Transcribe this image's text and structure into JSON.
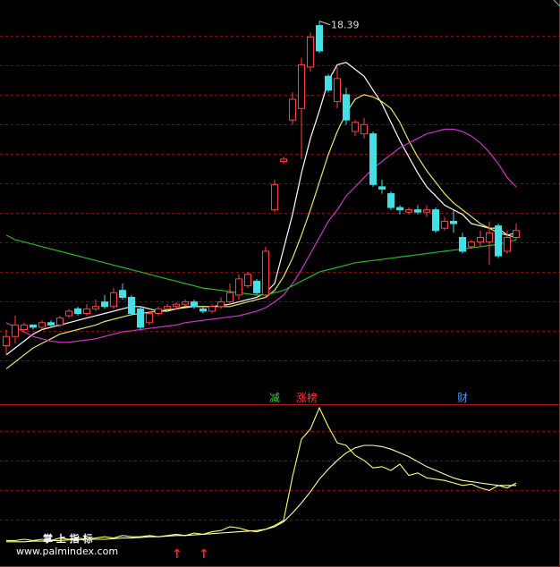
{
  "chart_data": [
    {
      "type": "candlestick",
      "panel": "price",
      "max_price_label": "18.39",
      "ylim": [
        3.0,
        19.0
      ],
      "grid": "horizontal dashed",
      "candles": [
        {
          "o": 4.3,
          "c": 4.7,
          "h": 5.0,
          "l": 3.9,
          "up": true
        },
        {
          "o": 4.7,
          "c": 5.2,
          "h": 5.6,
          "l": 4.4,
          "up": true
        },
        {
          "o": 5.0,
          "c": 5.2,
          "h": 5.3,
          "l": 4.9,
          "up": true
        },
        {
          "o": 5.2,
          "c": 5.1,
          "h": 5.2,
          "l": 5.0,
          "up": false
        },
        {
          "o": 5.1,
          "c": 5.3,
          "h": 5.4,
          "l": 5.0,
          "up": true
        },
        {
          "o": 5.3,
          "c": 5.2,
          "h": 5.4,
          "l": 5.1,
          "up": false
        },
        {
          "o": 5.2,
          "c": 5.5,
          "h": 5.6,
          "l": 5.1,
          "up": true
        },
        {
          "o": 5.6,
          "c": 5.8,
          "h": 5.9,
          "l": 5.5,
          "up": true
        },
        {
          "o": 5.9,
          "c": 5.7,
          "h": 6.0,
          "l": 5.6,
          "up": false
        },
        {
          "o": 5.7,
          "c": 5.9,
          "h": 6.1,
          "l": 5.6,
          "up": true
        },
        {
          "o": 5.9,
          "c": 6.0,
          "h": 6.3,
          "l": 5.8,
          "up": true
        },
        {
          "o": 6.2,
          "c": 6.0,
          "h": 6.5,
          "l": 5.9,
          "up": false
        },
        {
          "o": 6.0,
          "c": 6.6,
          "h": 6.8,
          "l": 5.9,
          "up": true
        },
        {
          "o": 6.7,
          "c": 6.4,
          "h": 7.0,
          "l": 6.3,
          "up": false
        },
        {
          "o": 6.4,
          "c": 5.7,
          "h": 6.5,
          "l": 5.6,
          "up": false
        },
        {
          "o": 5.9,
          "c": 5.1,
          "h": 6.0,
          "l": 5.0,
          "up": false
        },
        {
          "o": 5.3,
          "c": 5.7,
          "h": 5.8,
          "l": 5.2,
          "up": true
        },
        {
          "o": 5.7,
          "c": 5.9,
          "h": 6.0,
          "l": 5.6,
          "up": true
        },
        {
          "o": 5.9,
          "c": 6.0,
          "h": 6.1,
          "l": 5.8,
          "up": true
        },
        {
          "o": 6.0,
          "c": 6.1,
          "h": 6.2,
          "l": 5.9,
          "up": true
        },
        {
          "o": 6.1,
          "c": 6.2,
          "h": 6.3,
          "l": 6.0,
          "up": true
        },
        {
          "o": 6.2,
          "c": 6.0,
          "h": 6.3,
          "l": 5.9,
          "up": false
        },
        {
          "o": 5.9,
          "c": 5.8,
          "h": 6.0,
          "l": 5.7,
          "up": false
        },
        {
          "o": 5.8,
          "c": 6.0,
          "h": 6.1,
          "l": 5.7,
          "up": true
        },
        {
          "o": 6.0,
          "c": 6.2,
          "h": 6.4,
          "l": 5.9,
          "up": true
        },
        {
          "o": 6.2,
          "c": 6.6,
          "h": 7.0,
          "l": 6.1,
          "up": true
        },
        {
          "o": 6.5,
          "c": 7.2,
          "h": 7.4,
          "l": 6.3,
          "up": true
        },
        {
          "o": 6.9,
          "c": 7.4,
          "h": 7.5,
          "l": 6.8,
          "up": true
        },
        {
          "o": 7.1,
          "c": 6.6,
          "h": 7.2,
          "l": 6.5,
          "up": false
        },
        {
          "o": 6.5,
          "c": 8.4,
          "h": 8.6,
          "l": 6.4,
          "up": true
        },
        {
          "o": 10.2,
          "c": 11.3,
          "h": 11.5,
          "l": 10.1,
          "up": true
        },
        {
          "o": 12.3,
          "c": 12.4,
          "h": 12.5,
          "l": 12.2,
          "up": true
        },
        {
          "o": 14.1,
          "c": 15.0,
          "h": 15.3,
          "l": 13.9,
          "up": true
        },
        {
          "o": 14.6,
          "c": 16.5,
          "h": 16.8,
          "l": 12.4,
          "up": true
        },
        {
          "o": 16.4,
          "c": 17.7,
          "h": 17.9,
          "l": 16.2,
          "up": true
        },
        {
          "o": 18.2,
          "c": 17.1,
          "h": 18.39,
          "l": 17.0,
          "up": false
        },
        {
          "o": 16.0,
          "c": 15.4,
          "h": 16.1,
          "l": 15.3,
          "up": false
        },
        {
          "o": 14.9,
          "c": 15.9,
          "h": 16.4,
          "l": 14.6,
          "up": true
        },
        {
          "o": 15.2,
          "c": 14.1,
          "h": 15.5,
          "l": 13.9,
          "up": false
        },
        {
          "o": 13.6,
          "c": 14.0,
          "h": 14.1,
          "l": 13.4,
          "up": true
        },
        {
          "o": 13.5,
          "c": 13.9,
          "h": 14.2,
          "l": 13.3,
          "up": true
        },
        {
          "o": 13.5,
          "c": 11.3,
          "h": 13.6,
          "l": 11.2,
          "up": false
        },
        {
          "o": 11.2,
          "c": 11.1,
          "h": 11.5,
          "l": 10.9,
          "up": false
        },
        {
          "o": 10.9,
          "c": 10.3,
          "h": 11.0,
          "l": 10.2,
          "up": false
        },
        {
          "o": 10.3,
          "c": 10.2,
          "h": 10.4,
          "l": 10.0,
          "up": false
        },
        {
          "o": 10.1,
          "c": 10.2,
          "h": 10.3,
          "l": 10.0,
          "up": true
        },
        {
          "o": 10.2,
          "c": 10.1,
          "h": 10.4,
          "l": 10.0,
          "up": false
        },
        {
          "o": 10.1,
          "c": 10.2,
          "h": 10.4,
          "l": 9.9,
          "up": true
        },
        {
          "o": 10.2,
          "c": 9.3,
          "h": 10.3,
          "l": 9.2,
          "up": false
        },
        {
          "o": 9.4,
          "c": 9.7,
          "h": 9.9,
          "l": 9.3,
          "up": true
        },
        {
          "o": 9.7,
          "c": 9.6,
          "h": 10.2,
          "l": 9.2,
          "up": false
        },
        {
          "o": 9.0,
          "c": 8.4,
          "h": 9.2,
          "l": 8.3,
          "up": false
        },
        {
          "o": 8.6,
          "c": 8.8,
          "h": 8.9,
          "l": 8.5,
          "up": true
        },
        {
          "o": 8.8,
          "c": 9.0,
          "h": 9.3,
          "l": 8.6,
          "up": true
        },
        {
          "o": 8.8,
          "c": 9.2,
          "h": 9.7,
          "l": 7.8,
          "up": true
        },
        {
          "o": 9.5,
          "c": 8.2,
          "h": 9.6,
          "l": 8.1,
          "up": false
        },
        {
          "o": 8.4,
          "c": 9.0,
          "h": 9.3,
          "l": 8.3,
          "up": true
        },
        {
          "o": 9.0,
          "c": 9.3,
          "h": 9.6,
          "l": 8.9,
          "up": true
        }
      ],
      "ma_series": [
        {
          "color": "#ffffff",
          "values": [
            3.9,
            4.2,
            4.5,
            4.8,
            5.0,
            5.1,
            5.2,
            5.3,
            5.4,
            5.5,
            5.6,
            5.7,
            5.8,
            5.9,
            6.0,
            6.0,
            5.9,
            5.8,
            5.8,
            5.9,
            6.0,
            6.0,
            6.0,
            6.0,
            6.05,
            6.1,
            6.2,
            6.3,
            6.4,
            6.6,
            7.0,
            8.5,
            10.0,
            11.8,
            13.3,
            14.5,
            15.8,
            16.5,
            16.6,
            16.3,
            16.0,
            15.4,
            14.8,
            14.0,
            13.2,
            12.5,
            11.8,
            11.2,
            10.8,
            10.4,
            10.2,
            10.0,
            9.6,
            9.5,
            9.4,
            9.4,
            9.1,
            9.2
          ]
        },
        {
          "color": "#e8e85a",
          "values": [
            3.3,
            3.6,
            3.9,
            4.2,
            4.4,
            4.6,
            4.8,
            4.9,
            5.0,
            5.1,
            5.2,
            5.35,
            5.45,
            5.55,
            5.65,
            5.7,
            5.75,
            5.8,
            5.85,
            5.9,
            5.95,
            6.0,
            6.0,
            6.0,
            6.0,
            6.0,
            6.1,
            6.2,
            6.3,
            6.4,
            6.7,
            7.3,
            8.1,
            9.1,
            10.2,
            11.4,
            12.6,
            13.6,
            14.4,
            15.0,
            15.2,
            15.1,
            14.9,
            14.6,
            14.0,
            13.2,
            12.5,
            11.9,
            11.4,
            10.9,
            10.5,
            10.2,
            9.9,
            9.6,
            9.4,
            9.2,
            9.1,
            9.0
          ]
        },
        {
          "color": "#cc33cc",
          "values": [
            5.3,
            5.1,
            4.9,
            4.7,
            4.6,
            4.5,
            4.45,
            4.45,
            4.5,
            4.55,
            4.6,
            4.7,
            4.8,
            4.9,
            4.95,
            5.0,
            5.05,
            5.1,
            5.15,
            5.2,
            5.3,
            5.35,
            5.4,
            5.45,
            5.5,
            5.55,
            5.6,
            5.7,
            5.8,
            5.95,
            6.2,
            6.5,
            7.0,
            7.6,
            8.3,
            9.0,
            9.7,
            10.2,
            10.8,
            11.2,
            11.6,
            12.0,
            12.3,
            12.6,
            12.9,
            13.1,
            13.3,
            13.5,
            13.6,
            13.7,
            13.7,
            13.6,
            13.4,
            13.1,
            12.7,
            12.2,
            11.6,
            11.2
          ]
        },
        {
          "color": "#22bb22",
          "values": [
            9.1,
            8.9,
            8.8,
            8.7,
            8.6,
            8.5,
            8.4,
            8.3,
            8.2,
            8.1,
            8.0,
            7.9,
            7.8,
            7.7,
            7.6,
            7.5,
            7.4,
            7.3,
            7.2,
            7.1,
            7.0,
            6.9,
            6.8,
            6.75,
            6.7,
            6.65,
            6.6,
            6.55,
            6.5,
            6.5,
            6.6,
            6.7,
            6.9,
            7.1,
            7.3,
            7.5,
            7.6,
            7.7,
            7.8,
            7.9,
            7.95,
            8.0,
            8.05,
            8.1,
            8.15,
            8.2,
            8.25,
            8.3,
            8.35,
            8.4,
            8.45,
            8.5,
            8.55,
            8.6,
            8.65,
            8.7,
            8.8,
            8.9
          ]
        }
      ],
      "signals": [
        {
          "text": "减",
          "color": "#33cc33",
          "candle": 30
        },
        {
          "text": "涨榜",
          "color": "#ff3333",
          "candle": 33
        },
        {
          "text": "财",
          "color": "#3399ff",
          "candle": 51
        }
      ]
    },
    {
      "type": "line",
      "panel": "indicator",
      "ylim": [
        0,
        100
      ],
      "series": [
        {
          "color": "#ffff66",
          "values": [
            4,
            4,
            5,
            4,
            5,
            4,
            6,
            5,
            6,
            5,
            6,
            7,
            6,
            8,
            7,
            7,
            8,
            7,
            8,
            9,
            8,
            10,
            9,
            11,
            12,
            15,
            14,
            12,
            11,
            13,
            16,
            20,
            55,
            85,
            93,
            110,
            95,
            82,
            80,
            72,
            68,
            62,
            63,
            60,
            65,
            56,
            58,
            54,
            53,
            52,
            50,
            48,
            49,
            46,
            44,
            48,
            46,
            50
          ]
        },
        {
          "color": "#ffffaa",
          "values": [
            3,
            3,
            3,
            3.5,
            3.5,
            4,
            4,
            4.5,
            4.5,
            5,
            5,
            5,
            5.5,
            6,
            6,
            6.5,
            7,
            7,
            7.5,
            8,
            8,
            8.5,
            9,
            9.5,
            10,
            10.5,
            11,
            11.5,
            12,
            13,
            15,
            19,
            26,
            34,
            43,
            53,
            61,
            68,
            74,
            78,
            80,
            80,
            79,
            77,
            74,
            71,
            67,
            63,
            60,
            57,
            54,
            52,
            51,
            50,
            49,
            48,
            48,
            48
          ]
        }
      ],
      "markers": [
        {
          "symbol": "↑",
          "color": "#ff2020",
          "candle": 19
        },
        {
          "symbol": "↑",
          "color": "#ff2020",
          "candle": 22
        }
      ]
    }
  ],
  "watermark": {
    "title": "掌 上 指 标",
    "url": "www.palmindex.com"
  },
  "colors": {
    "up": "#ff4040",
    "down": "#44e0e8",
    "grid": "#7a1010",
    "divider": "#b01818"
  }
}
